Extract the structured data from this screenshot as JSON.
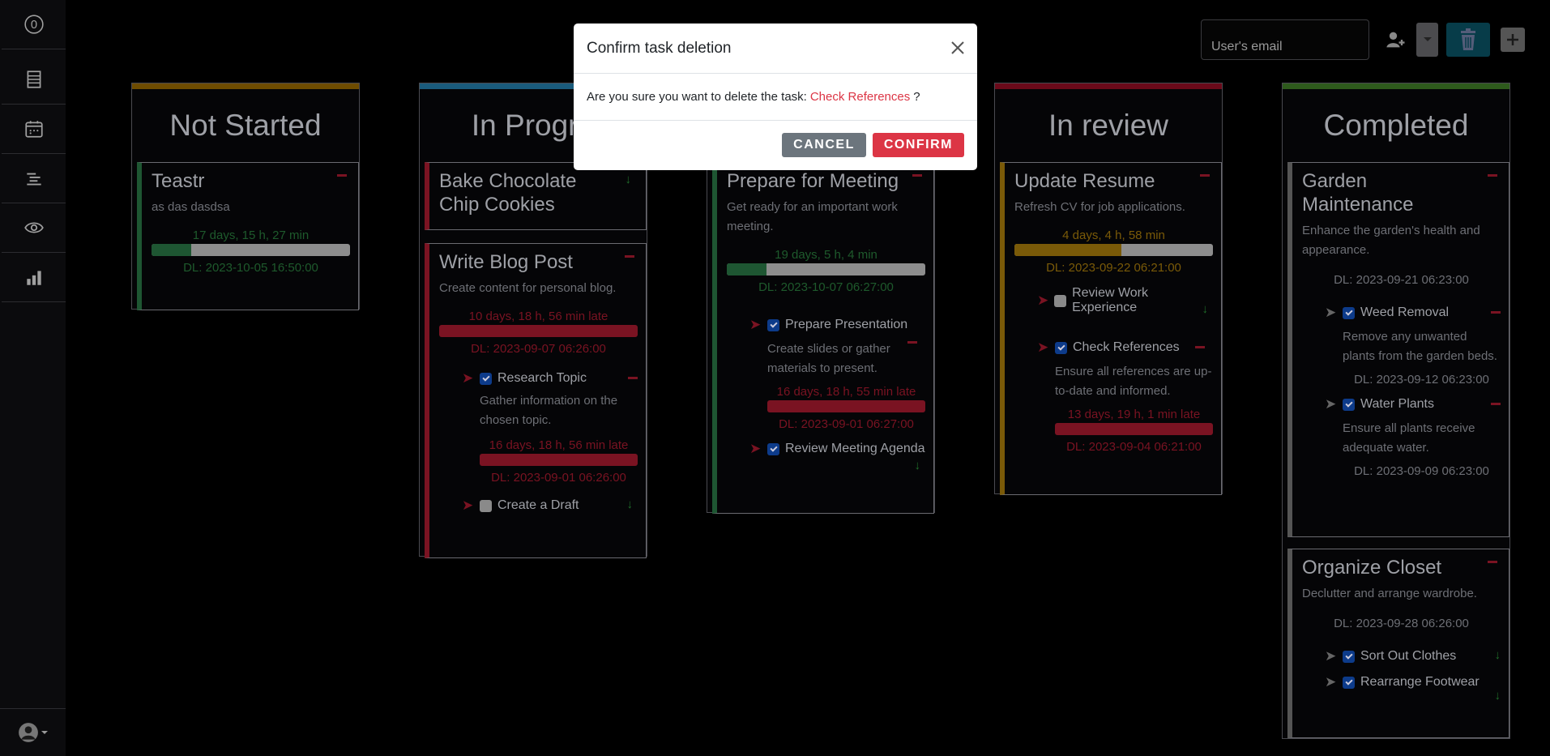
{
  "sidebar": {
    "items": [
      {
        "name": "timer-icon",
        "label": "0"
      },
      {
        "name": "list-icon"
      },
      {
        "name": "calendar-icon"
      },
      {
        "name": "gantt-icon"
      },
      {
        "name": "eye-icon"
      },
      {
        "name": "chart-icon"
      }
    ],
    "user_icon": "user-icon"
  },
  "topbar": {
    "email_placeholder": "User's email"
  },
  "columns": [
    {
      "title": "Not Started",
      "color": "#6e4c00"
    },
    {
      "title": "In Progress",
      "color": "#1a5b7c"
    },
    {
      "title": "In Review",
      "color": "#6b0a1a"
    },
    {
      "title": "Completed",
      "color": "#2e5a1c"
    }
  ],
  "board": {
    "notstarted": {
      "title": "Not Started",
      "cards": [
        {
          "title": "Teastr",
          "desc": "as das dasdsa",
          "time": "17 days, 15 h, 27 min",
          "progress": 0.2,
          "dl": "DL: 2023-10-05 16:50:00"
        }
      ]
    },
    "inprogress": {
      "title": "In Progre",
      "cards": [
        {
          "title": "Bake Chocolate Chip Cookies"
        },
        {
          "title": "Write Blog Post",
          "desc": "Create content for personal blog.",
          "time": "10 days, 18 h, 56 min late",
          "dl": "DL: 2023-09-07 06:26:00",
          "subtasks": [
            {
              "title": "Research Topic",
              "desc": "Gather information on the chosen topic.",
              "time": "16 days, 18 h, 56 min late",
              "dl": "DL: 2023-09-01 06:26:00"
            },
            {
              "title": "Create a Draft"
            }
          ]
        }
      ]
    },
    "meeting": {
      "title": "Prepare for Meeting",
      "desc": "Get ready for an important work meeting.",
      "time": "19 days, 5 h, 4 min",
      "progress": 0.2,
      "dl": "DL: 2023-10-07 06:27:00",
      "subtasks": [
        {
          "title": "Prepare Presentation",
          "desc": "Create slides or gather materials to present.",
          "time": "16 days, 18 h, 55 min late",
          "dl": "DL: 2023-09-01 06:27:00"
        },
        {
          "title": "Review Meeting Agenda"
        }
      ]
    },
    "inreview": {
      "title": "In review",
      "cards": [
        {
          "title": "Update Resume",
          "desc": "Refresh CV for job applications.",
          "time": "4 days, 4 h, 58 min",
          "progress": 0.54,
          "dl": "DL: 2023-09-22 06:21:00",
          "subtasks": [
            {
              "title": "Review Work Experience"
            },
            {
              "title": "Check References",
              "desc": "Ensure all references are up-to-date and informed.",
              "time": "13 days, 19 h, 1 min late",
              "dl": "DL: 2023-09-04 06:21:00"
            }
          ]
        }
      ]
    },
    "completed": {
      "title": "Completed",
      "cards": [
        {
          "title": "Garden Maintenance",
          "desc": "Enhance the garden's health and appearance.",
          "dl": "DL: 2023-09-21 06:23:00",
          "subtasks": [
            {
              "title": "Weed Removal",
              "desc": "Remove any unwanted plants from the garden beds.",
              "dl": "DL: 2023-09-12 06:23:00"
            },
            {
              "title": "Water Plants",
              "desc": "Ensure all plants receive adequate water.",
              "dl": "DL: 2023-09-09 06:23:00"
            }
          ]
        },
        {
          "title": "Organize Closet",
          "desc": "Declutter and arrange wardrobe.",
          "dl": "DL: 2023-09-28 06:26:00",
          "subtasks": [
            {
              "title": "Sort Out Clothes"
            },
            {
              "title": "Rearrange Footwear"
            }
          ]
        }
      ]
    }
  },
  "modal": {
    "title": "Confirm task deletion",
    "body_prefix": "Are you sure you want to delete the task:",
    "task_name": "Check References",
    "body_suffix": "?",
    "cancel_label": "CANCEL",
    "confirm_label": "CONFIRM"
  }
}
